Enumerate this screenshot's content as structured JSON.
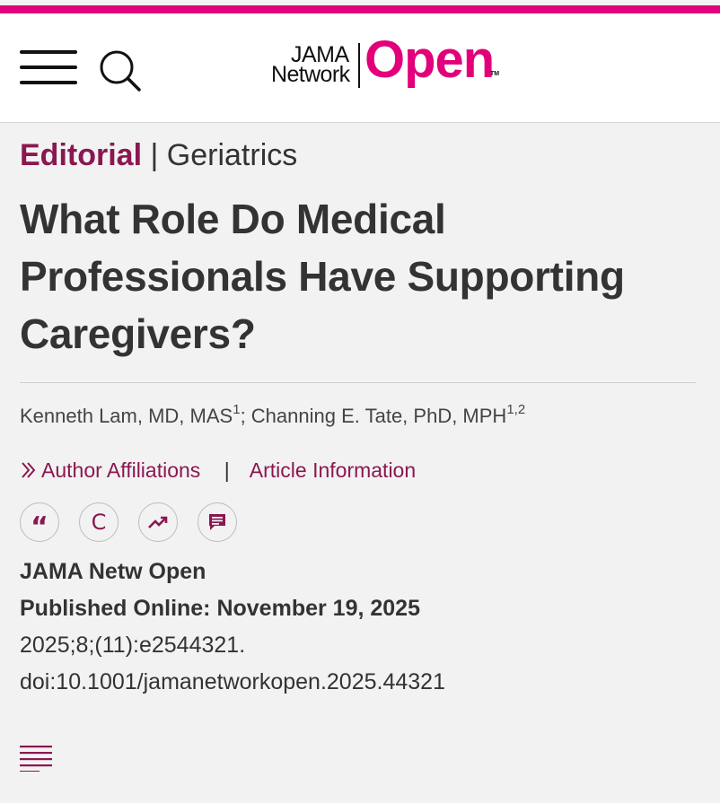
{
  "colors": {
    "brand": "#e2007a",
    "section": "#8a1850",
    "link": "#8a1850"
  },
  "header": {
    "logo": {
      "jama": "JAMA",
      "network": "Network",
      "open": "Open",
      "tm": "TM"
    },
    "icons": {
      "menu": "hamburger-menu-icon",
      "search": "search-icon"
    }
  },
  "article": {
    "section_type": "Editorial",
    "separator": "|",
    "subject": "Geriatrics",
    "title": "What Role Do Medical Professionals Have Supporting Caregivers?",
    "authors": [
      {
        "name": "Kenneth Lam, MD, MAS",
        "affil": "1"
      },
      {
        "name": "Channing E. Tate, PhD, MPH",
        "affil": "1,2"
      }
    ],
    "author_sep": "; ",
    "links": {
      "author_affiliations": "Author Affiliations",
      "pipe": "|",
      "article_information": "Article Information"
    },
    "actions": [
      {
        "name": "cite",
        "icon": "quote-icon",
        "glyph": "“"
      },
      {
        "name": "permissions",
        "icon": "copyright-icon",
        "glyph": "C"
      },
      {
        "name": "metrics",
        "icon": "trending-up-icon"
      },
      {
        "name": "comment",
        "icon": "comment-icon"
      }
    ],
    "journal": "JAMA Netw Open",
    "published": "Published Online: November 19, 2025",
    "citation": "2025;8;(11):e2544321.",
    "doi": "doi:10.1001/jamanetworkopen.2025.44321"
  },
  "toc": {
    "icon": "table-of-contents-icon"
  }
}
